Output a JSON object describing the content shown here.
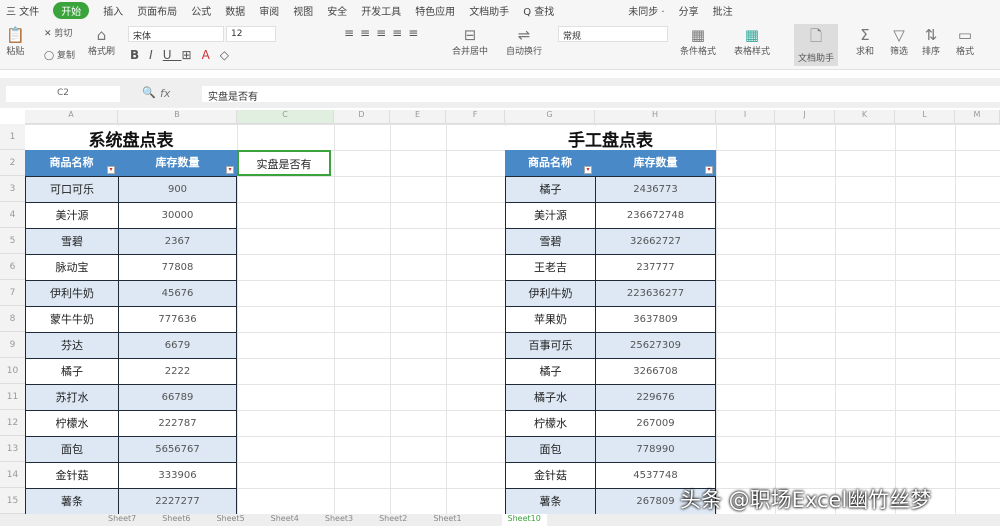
{
  "menu": [
    "三 文件",
    "开始",
    "插入",
    "页面布局",
    "公式",
    "数据",
    "审阅",
    "视图",
    "安全",
    "开发工具",
    "特色应用",
    "文档助手",
    "Q 查找",
    "未同步 ·",
    "分享",
    "批注"
  ],
  "ribbon": {
    "paste": "粘贴",
    "cut": "剪切",
    "copy": "复制",
    "format_painter": "格式刷",
    "font": "宋体",
    "size": "12",
    "merge": "合并居中",
    "wrap": "自动换行",
    "numfmt": "常规",
    "cond": "条件格式",
    "table_style": "表格样式",
    "doc_helper": "文档助手",
    "sum": "求和",
    "filter": "筛选",
    "sort": "排序",
    "format": "格式"
  },
  "formula": {
    "cell_ref": "C2",
    "fx": "fx",
    "value": "实盘是否有"
  },
  "columns": [
    "A",
    "B",
    "C",
    "D",
    "E",
    "F",
    "G",
    "H",
    "I",
    "J",
    "K",
    "L",
    "M"
  ],
  "rows": [
    "1",
    "2",
    "3",
    "4",
    "5",
    "6",
    "7",
    "8",
    "9",
    "10",
    "11",
    "12",
    "13",
    "14",
    "15"
  ],
  "left": {
    "title": "系统盘点表",
    "headers": [
      "商品名称",
      "库存数量"
    ],
    "items": [
      [
        "可口可乐",
        "900"
      ],
      [
        "美汁源",
        "30000"
      ],
      [
        "雪碧",
        "2367"
      ],
      [
        "脉动宝",
        "77808"
      ],
      [
        "伊利牛奶",
        "45676"
      ],
      [
        "蒙牛牛奶",
        "777636"
      ],
      [
        "芬达",
        "6679"
      ],
      [
        "橘子",
        "2222"
      ],
      [
        "苏打水",
        "66789"
      ],
      [
        "柠檬水",
        "222787"
      ],
      [
        "面包",
        "5656767"
      ],
      [
        "金针菇",
        "333906"
      ],
      [
        "薯条",
        "2227277"
      ]
    ]
  },
  "c2": "实盘是否有",
  "right": {
    "title": "手工盘点表",
    "headers": [
      "商品名称",
      "库存数量"
    ],
    "items": [
      [
        "橘子",
        "2436773"
      ],
      [
        "美汁源",
        "236672748"
      ],
      [
        "雪碧",
        "32662727"
      ],
      [
        "王老吉",
        "237777"
      ],
      [
        "伊利牛奶",
        "223636277"
      ],
      [
        "苹果奶",
        "3637809"
      ],
      [
        "百事可乐",
        "25627309"
      ],
      [
        "橘子",
        "3266708"
      ],
      [
        "橘子水",
        "229676"
      ],
      [
        "柠檬水",
        "267009"
      ],
      [
        "面包",
        "778990"
      ],
      [
        "金针菇",
        "4537748"
      ],
      [
        "薯条",
        "267809"
      ]
    ]
  },
  "sheets": [
    "Sheet7",
    "Sheet6",
    "Sheet5",
    "Sheet4",
    "Sheet3",
    "Sheet2",
    "Sheet1",
    "Sheet10"
  ],
  "watermark": "头条 @职场Excel幽竹丝梦"
}
